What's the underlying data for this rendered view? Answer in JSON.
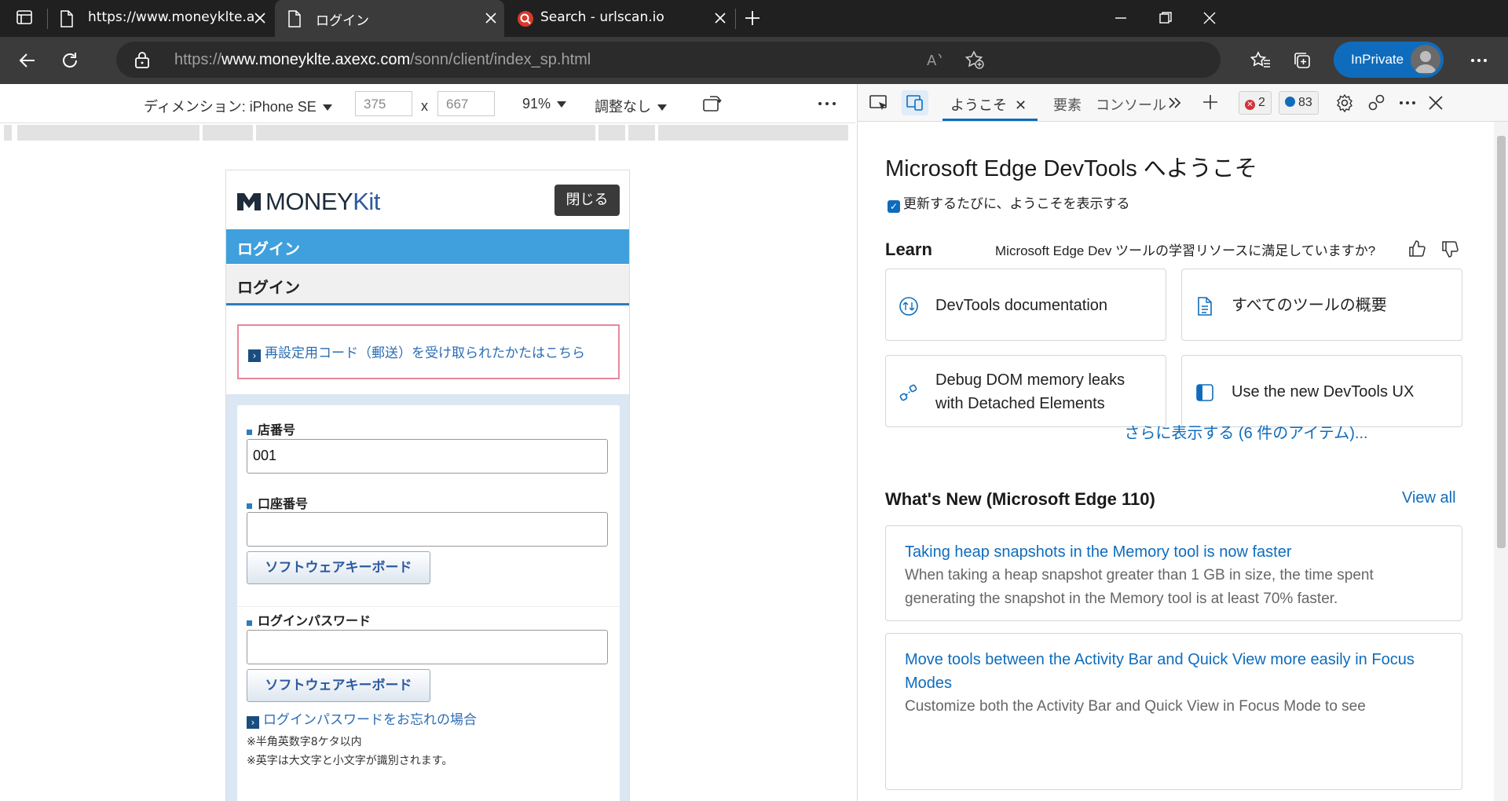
{
  "tabs": [
    {
      "title": "https://www.moneyklte.axexc.co",
      "icon": "page-icon"
    },
    {
      "title": "ログイン",
      "icon": "page-icon"
    },
    {
      "title": "Search - urlscan.io",
      "icon": "urlscan-favicon-icon"
    }
  ],
  "address": {
    "scheme": "https://",
    "host": "www.moneyklte.axexc.com",
    "path": "/sonn/client/index_sp.html"
  },
  "inprivate_label": "InPrivate",
  "device": {
    "dimension_label": "ディメンション: iPhone SE",
    "width": "375",
    "height": "667",
    "times": "x",
    "zoom": "91%",
    "throttle": "調整なし"
  },
  "site": {
    "logo_text": "MONEY",
    "logo_text_accent": "Kit",
    "close_button": "閉じる",
    "login_bar": "ログイン",
    "login_heading": "ログイン",
    "notice_link": "再設定用コード（郵送）を受け取られたかたはこちら",
    "fields": {
      "branch_label": "店番号",
      "branch_value": "001",
      "account_label": "口座番号",
      "account_value": "",
      "password_label": "ログインパスワード",
      "password_value": ""
    },
    "keyboard_button": "ソフトウェアキーボード",
    "forgot_link": "ログインパスワードをお忘れの場合",
    "note1": "※半角英数字8ケタ以内",
    "note2": "※英字は大文字と小文字が識別されます。"
  },
  "devtools": {
    "tabs": {
      "welcome": "ようこそ",
      "elements": "要素",
      "console": "コンソール"
    },
    "errors": "2",
    "messages": "83",
    "title": "Microsoft Edge DevTools へようこそ",
    "checkbox_label": "更新するたびに、ようこそを表示する",
    "learn_heading": "Learn",
    "learn_question": "Microsoft Edge Dev ツールの学習リソースに満足していますか?",
    "cards": [
      {
        "label": "DevTools documentation",
        "icon": "docs-icon"
      },
      {
        "label": "すべてのツールの概要",
        "icon": "document-icon"
      },
      {
        "label": "Debug DOM memory leaks with Detached Elements",
        "icon": "detached-elements-icon"
      },
      {
        "label": "Use the new DevTools UX",
        "icon": "panel-icon"
      }
    ],
    "more_link": "さらに表示する (6 件のアイテム)...",
    "whats_new_heading": "What's New (Microsoft Edge 110)",
    "view_all": "View all",
    "news": [
      {
        "title": "Taking heap snapshots in the Memory tool is now faster",
        "desc": "When taking a heap snapshot greater than 1 GB in size, the time spent generating the snapshot in the Memory tool is at least 70% faster."
      },
      {
        "title": "Move tools between the Activity Bar and Quick View more easily in Focus Modes",
        "desc": "Customize both the Activity Bar and Quick View in Focus Mode to see"
      }
    ]
  },
  "colors": {
    "accent": "#0f6cbd",
    "site_blue": "#3fa0dd",
    "notice_border": "#e8879b"
  }
}
